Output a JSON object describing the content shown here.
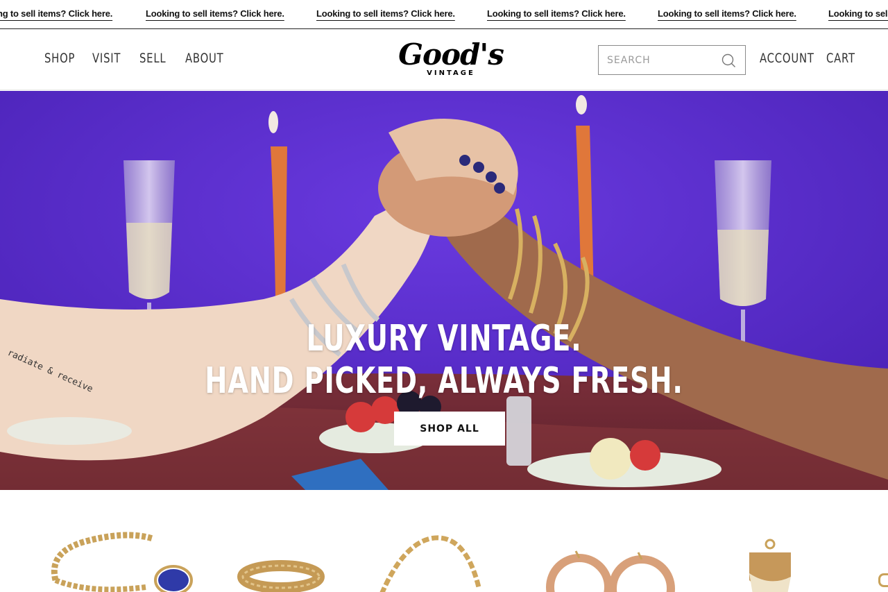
{
  "announcement": {
    "text": "Looking to sell items? Click here.",
    "partial_left": "ng to sell items? Click here.",
    "partial_right": "Looking to sell"
  },
  "header": {
    "nav_left": [
      "SHOP",
      "VISIT",
      "SELL",
      "ABOUT"
    ],
    "logo": {
      "main": "Good's",
      "sub": "VINTAGE"
    },
    "search": {
      "placeholder": "SEARCH",
      "value": ""
    },
    "nav_right": [
      "ACCOUNT",
      "CART"
    ]
  },
  "hero": {
    "line1": "LUXURY VINTAGE.",
    "line2": "HAND PICKED, ALWAYS FRESH.",
    "cta": "SHOP ALL",
    "tattoo_text": "radiate & receive"
  },
  "products": [
    {
      "icon": "gold-curb-bracelet-icon"
    },
    {
      "icon": "gold-band-ring-icon"
    },
    {
      "icon": "gold-figaro-chain-icon"
    },
    {
      "icon": "gold-hoop-earrings-icon"
    },
    {
      "icon": "gold-claw-pendant-icon"
    }
  ],
  "colors": {
    "hero_background": "#5a2fd0",
    "gold": "#c9a25a",
    "button_bg": "#ffffff",
    "text": "#111111"
  }
}
